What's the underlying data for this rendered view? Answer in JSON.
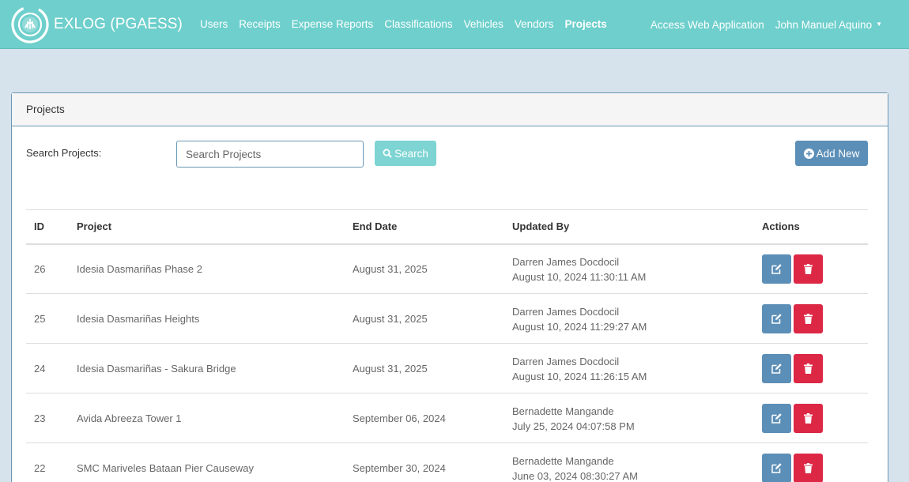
{
  "brand": {
    "name": "EXLOG (PGAESS)",
    "logo_icon": "logo-icon"
  },
  "nav": {
    "items": [
      {
        "label": "Users",
        "active": false
      },
      {
        "label": "Receipts",
        "active": false
      },
      {
        "label": "Expense Reports",
        "active": false
      },
      {
        "label": "Classifications",
        "active": false
      },
      {
        "label": "Vehicles",
        "active": false
      },
      {
        "label": "Vendors",
        "active": false
      },
      {
        "label": "Projects",
        "active": true
      }
    ],
    "right": {
      "access_label": "Access Web Application",
      "user_name": "John Manuel Aquino"
    }
  },
  "panel": {
    "title": "Projects",
    "search_label": "Search Projects:",
    "search_placeholder": "Search Projects",
    "search_value": "",
    "search_button": "Search",
    "add_button": "Add New"
  },
  "table": {
    "columns": [
      "ID",
      "Project",
      "End Date",
      "Updated By",
      "Actions"
    ],
    "rows": [
      {
        "id": "26",
        "project": "Idesia Dasmariñas Phase 2",
        "end_date": "August 31, 2025",
        "updated_by": "Darren James Docdocil",
        "updated_at": "August 10, 2024 11:30:11 AM"
      },
      {
        "id": "25",
        "project": "Idesia Dasmariñas Heights",
        "end_date": "August 31, 2025",
        "updated_by": "Darren James Docdocil",
        "updated_at": "August 10, 2024 11:29:27 AM"
      },
      {
        "id": "24",
        "project": "Idesia Dasmariñas - Sakura Bridge",
        "end_date": "August 31, 2025",
        "updated_by": "Darren James Docdocil",
        "updated_at": "August 10, 2024 11:26:15 AM"
      },
      {
        "id": "23",
        "project": "Avida Abreeza Tower 1",
        "end_date": "September 06, 2024",
        "updated_by": "Bernadette Mangande",
        "updated_at": "July 25, 2024 04:07:58 PM"
      },
      {
        "id": "22",
        "project": "SMC Mariveles Bataan Pier Causeway",
        "end_date": "September 30, 2024",
        "updated_by": "Bernadette Mangande",
        "updated_at": "June 03, 2024 08:30:27 AM"
      }
    ]
  },
  "colors": {
    "navbar": "#6ecfcc",
    "background": "#d6e2ec",
    "primary": "#5c8fb7",
    "danger": "#dc2745",
    "info": "#7dd4d2"
  }
}
